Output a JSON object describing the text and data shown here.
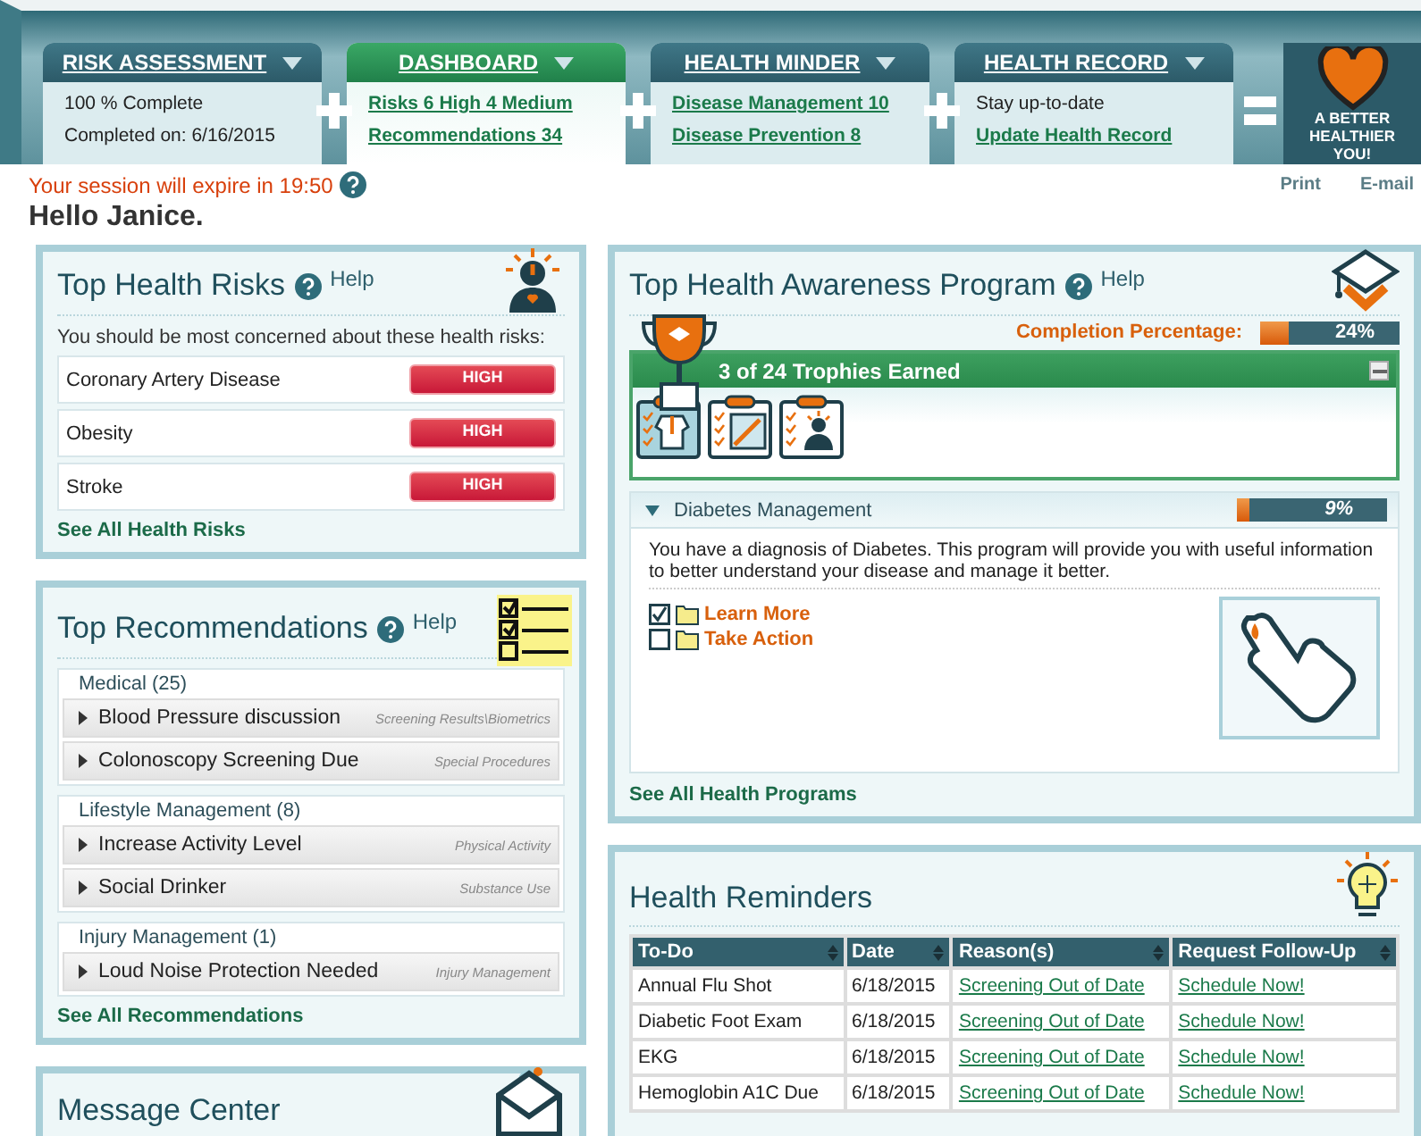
{
  "nav_tabs": [
    {
      "title": "RISK ASSESSMENT",
      "selected": false,
      "lines": [
        {
          "kind": "text",
          "text": "100 % Complete"
        },
        {
          "kind": "text",
          "text": "Completed on: 6/16/2015"
        }
      ]
    },
    {
      "title": "DASHBOARD",
      "selected": true,
      "lines": [
        {
          "kind": "link",
          "text": "Risks 6 High 4 Medium"
        },
        {
          "kind": "link",
          "text": "Recommendations 34"
        }
      ]
    },
    {
      "title": "HEALTH MINDER",
      "selected": false,
      "lines": [
        {
          "kind": "link",
          "text": "Disease Management 10"
        },
        {
          "kind": "link",
          "text": "Disease Prevention 8"
        }
      ]
    },
    {
      "title": "HEALTH RECORD",
      "selected": false,
      "lines": [
        {
          "kind": "text",
          "text": "Stay up-to-date"
        },
        {
          "kind": "link",
          "text": "Update Health Record"
        }
      ]
    }
  ],
  "brand": {
    "slogan": "A BETTER HEALTHIER YOU!"
  },
  "session_notice": "Your session will expire in 19:50",
  "page_actions": [
    "Print",
    "E-mail"
  ],
  "greeting": "Hello Janice.",
  "health_risks": {
    "title": "Top Health Risks",
    "help": "Help",
    "intro": "You should be most concerned about these health risks:",
    "items": [
      {
        "name": "Coronary Artery Disease",
        "risk": "HIGH"
      },
      {
        "name": "Obesity",
        "risk": "HIGH"
      },
      {
        "name": "Stroke",
        "risk": "HIGH"
      }
    ],
    "link": "See All Health Risks"
  },
  "recommendations": {
    "title": "Top Recommendations",
    "help": "Help",
    "groups": [
      {
        "name": "Medical (25)",
        "items": [
          {
            "title": "Blood Pressure discussion",
            "category": "Screening Results\\Biometrics"
          },
          {
            "title": "Colonoscopy Screening Due",
            "category": "Special Procedures"
          }
        ]
      },
      {
        "name": "Lifestyle Management (8)",
        "items": [
          {
            "title": "Increase Activity Level",
            "category": "Physical Activity"
          },
          {
            "title": "Social Drinker",
            "category": "Substance Use"
          }
        ]
      },
      {
        "name": "Injury Management (1)",
        "items": [
          {
            "title": "Loud Noise Protection Needed",
            "category": "Injury Management"
          }
        ]
      }
    ],
    "link": "See All Recommendations"
  },
  "message_center": {
    "title": "Message Center"
  },
  "awareness": {
    "title": "Top Health Awareness Program",
    "help": "Help",
    "completion_label": "Completion Percentage:",
    "completion": {
      "level": 0.2,
      "reading": "24%"
    },
    "trophies_title": "3 of 24 Trophies Earned",
    "trophies_expanded": true,
    "trophies": [
      {
        "kind": "coat",
        "selected": true
      },
      {
        "kind": "syringe",
        "selected": false
      },
      {
        "kind": "person",
        "selected": false
      }
    ],
    "program": {
      "name": "Diabetes Management",
      "expanded": true,
      "progress": {
        "level": 0.08,
        "reading": "9%"
      },
      "description": "You have a diagnosis of Diabetes. This program will provide you with useful information to better understand your disease and manage it better.",
      "tasks": [
        {
          "label": "Learn More",
          "checked": true
        },
        {
          "label": "Take Action",
          "checked": false
        }
      ]
    },
    "link": "See All Health Programs"
  },
  "reminders": {
    "title": "Health Reminders",
    "columns": [
      "To-Do",
      "Date",
      "Reason(s)",
      "Request Follow-Up"
    ],
    "rows": [
      [
        "Annual Flu Shot",
        "6/18/2015",
        "Screening Out of Date",
        "Schedule Now!"
      ],
      [
        "Diabetic Foot Exam",
        "6/18/2015",
        "Screening Out of Date",
        "Schedule Now!"
      ],
      [
        "EKG",
        "6/18/2015",
        "Screening Out of Date",
        "Schedule Now!"
      ],
      [
        "Hemoglobin A1C Due",
        "6/18/2015",
        "Screening Out of Date",
        "Schedule Now!"
      ]
    ]
  }
}
